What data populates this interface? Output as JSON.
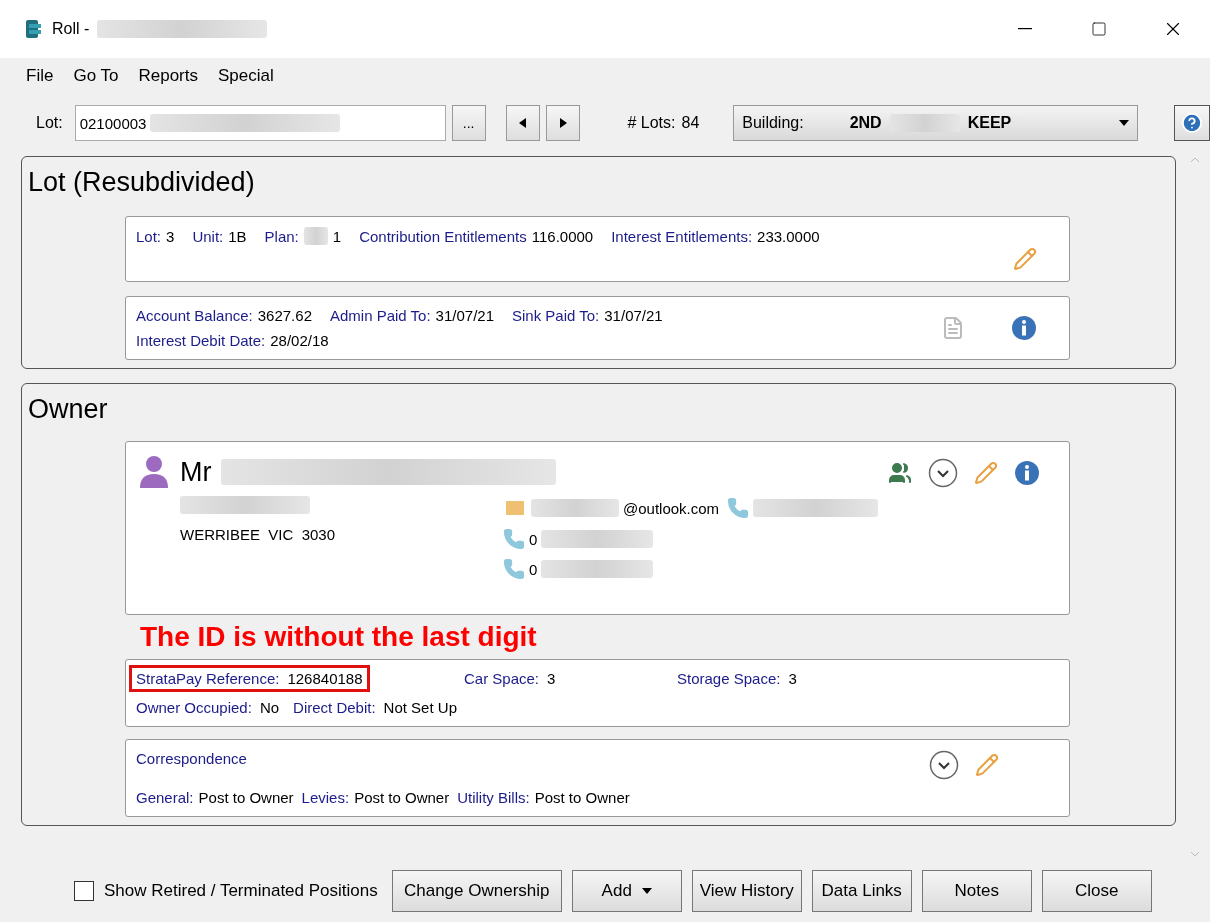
{
  "window": {
    "title": "Roll -"
  },
  "menu": [
    "File",
    "Go To",
    "Reports",
    "Special"
  ],
  "toolbar": {
    "lot_label": "Lot:",
    "lot_value": "02100003",
    "browse": "...",
    "lots_label": "# Lots:",
    "lots_count": "84",
    "building_label": "Building:",
    "building_parts": [
      "2ND",
      "KEEP"
    ]
  },
  "lot_section": {
    "title": "Lot (Resubdivided)",
    "cards": [
      {
        "kind": "entitlements",
        "rows": [
          [
            {
              "label": "Lot:",
              "value": "3"
            },
            {
              "label": "Unit:",
              "value": "1B"
            },
            {
              "label": "Plan:",
              "value": "1",
              "redacted": true
            },
            {
              "label": "Contribution Entitlements",
              "value": "116.0000"
            },
            {
              "label": "Interest Entitlements:",
              "value": "233.0000"
            }
          ]
        ]
      },
      {
        "kind": "account",
        "rows": [
          [
            {
              "label": "Account Balance:",
              "value": "3627.62"
            },
            {
              "label": "Admin Paid To:",
              "value": "31/07/21"
            },
            {
              "label": "Sink Paid To:",
              "value": "31/07/21"
            }
          ],
          [
            {
              "label": "Interest Debit Date:",
              "value": "28/02/18"
            }
          ]
        ]
      }
    ]
  },
  "owner_section": {
    "title": "Owner",
    "person": {
      "salutation": "Mr",
      "address": [
        "WERRIBEE  VIC  3030"
      ],
      "contacts": [
        {
          "kind": "email",
          "text": "@outlook.com"
        },
        {
          "kind": "phone",
          "text": "0"
        },
        {
          "kind": "phone",
          "text": "0"
        }
      ]
    },
    "annotation": "The ID is without the last digit",
    "details": {
      "rows": [
        [
          {
            "label": "StrataPay Reference:",
            "value": "126840188",
            "highlighted": true
          },
          {
            "label": "Car Space:",
            "value": "3"
          },
          {
            "label": "Storage Space:",
            "value": "3"
          }
        ],
        [
          {
            "label": "Owner Occupied:",
            "value": "No"
          },
          {
            "label": "Direct Debit:",
            "value": "Not Set Up"
          }
        ]
      ]
    },
    "correspondence": {
      "title": "Correspondence",
      "fields": [
        {
          "label": "General:",
          "value": "Post to Owner"
        },
        {
          "label": "Levies:",
          "value": "Post to Owner"
        },
        {
          "label": "Utility Bills:",
          "value": "Post to Owner"
        }
      ]
    }
  },
  "footer": {
    "checkbox": {
      "label": "Show Retired / Terminated Positions",
      "checked": false
    },
    "buttons": [
      {
        "label": "Change Ownership",
        "dropdown": false
      },
      {
        "label": "Add",
        "dropdown": true
      },
      {
        "label": "View History",
        "dropdown": false
      },
      {
        "label": "Data Links",
        "dropdown": false
      },
      {
        "label": "Notes",
        "dropdown": false
      },
      {
        "label": "Close",
        "dropdown": false
      }
    ]
  }
}
